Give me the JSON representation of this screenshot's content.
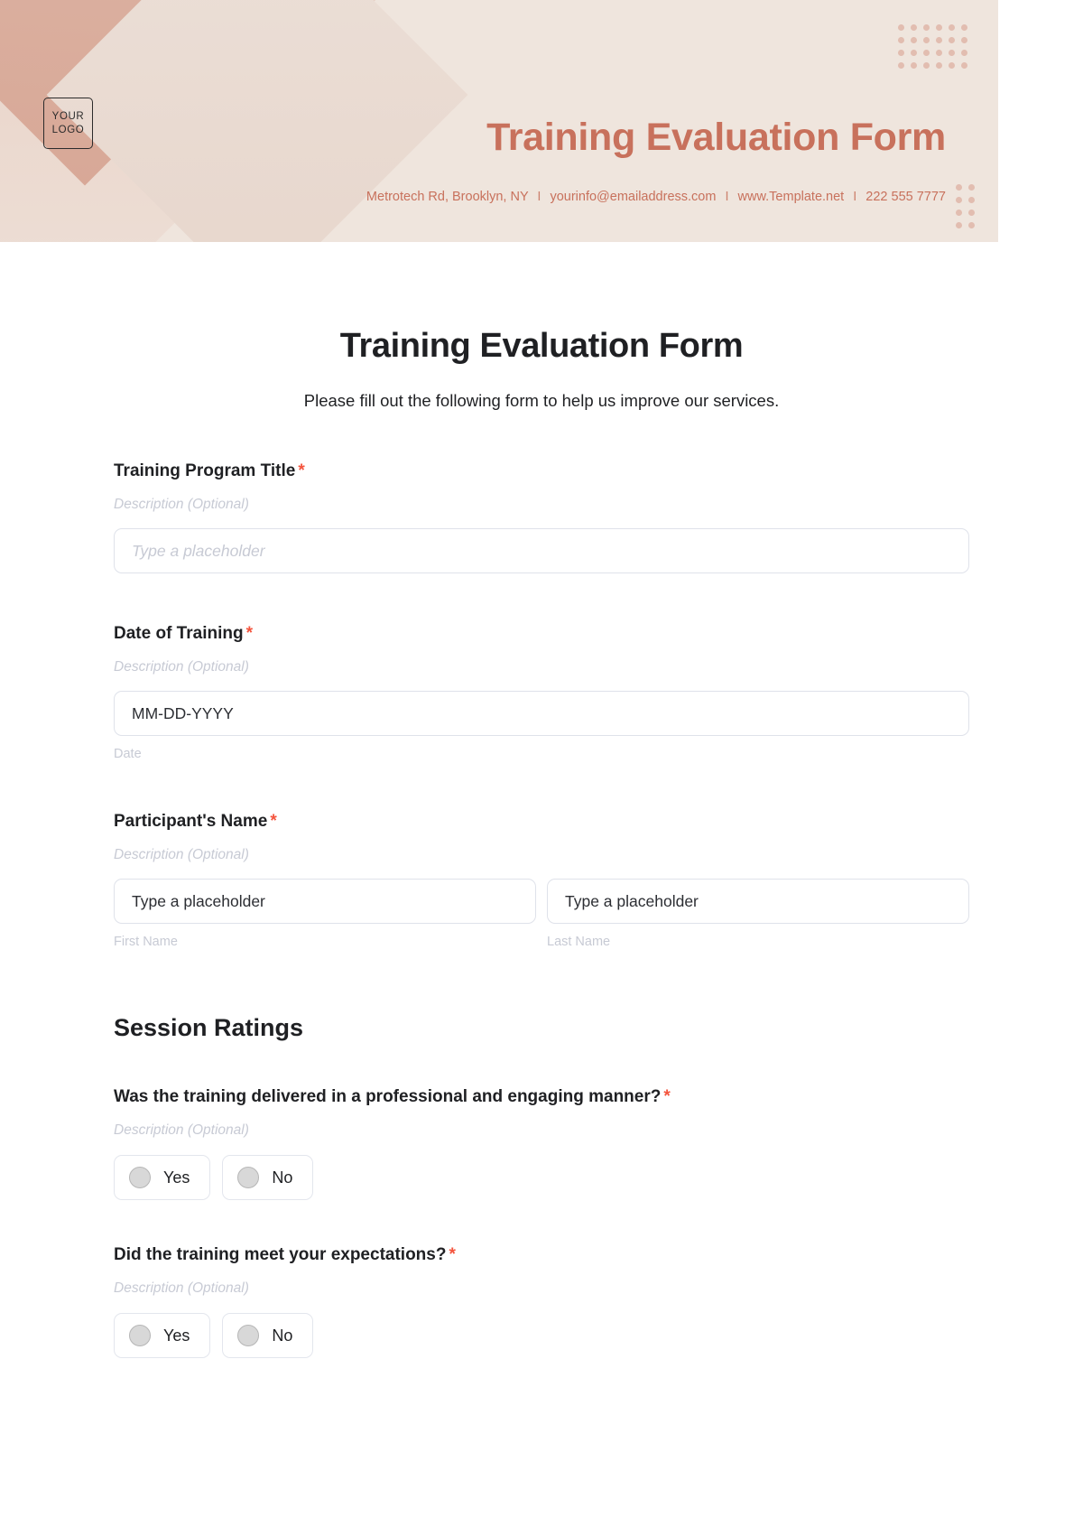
{
  "header": {
    "logo_line1": "YOUR",
    "logo_line2": "LOGO",
    "title": "Training Evaluation Form",
    "contact": {
      "address": "Metrotech Rd, Brooklyn, NY",
      "email": "yourinfo@emailaddress.com",
      "website": "www.Template.net",
      "phone": "222 555 7777",
      "separator": "I"
    },
    "accent_color": "#c8715c",
    "background_color": "#efe5dd",
    "dot_color": "#e2bdb0"
  },
  "form": {
    "title": "Training Evaluation Form",
    "subtitle": "Please fill out the following form to help us improve our services.",
    "required_marker": "*",
    "required_color": "#f4543d",
    "description_text": "Description (Optional)",
    "fields": [
      {
        "label": "Training Program Title",
        "description": "Description (Optional)",
        "required": true,
        "value": "Type a placeholder",
        "is_placeholder": true,
        "sub_label": ""
      },
      {
        "label": "Date of Training",
        "description": "Description (Optional)",
        "required": true,
        "value": "MM-DD-YYYY",
        "is_placeholder": false,
        "sub_label": "Date"
      }
    ],
    "name_field": {
      "label": "Participant's Name",
      "description": "Description (Optional)",
      "required": true,
      "first": {
        "value": "Type a placeholder",
        "sub_label": "First Name"
      },
      "last": {
        "value": "Type a placeholder",
        "sub_label": "Last Name"
      }
    },
    "section": {
      "heading": "Session Ratings",
      "questions": [
        {
          "label": "Was the training delivered in a professional and engaging manner?",
          "description": "Description (Optional)",
          "required": true,
          "options": [
            "Yes",
            "No"
          ]
        },
        {
          "label": "Did the training meet your expectations?",
          "description": "Description (Optional)",
          "required": true,
          "options": [
            "Yes",
            "No"
          ]
        }
      ]
    }
  }
}
